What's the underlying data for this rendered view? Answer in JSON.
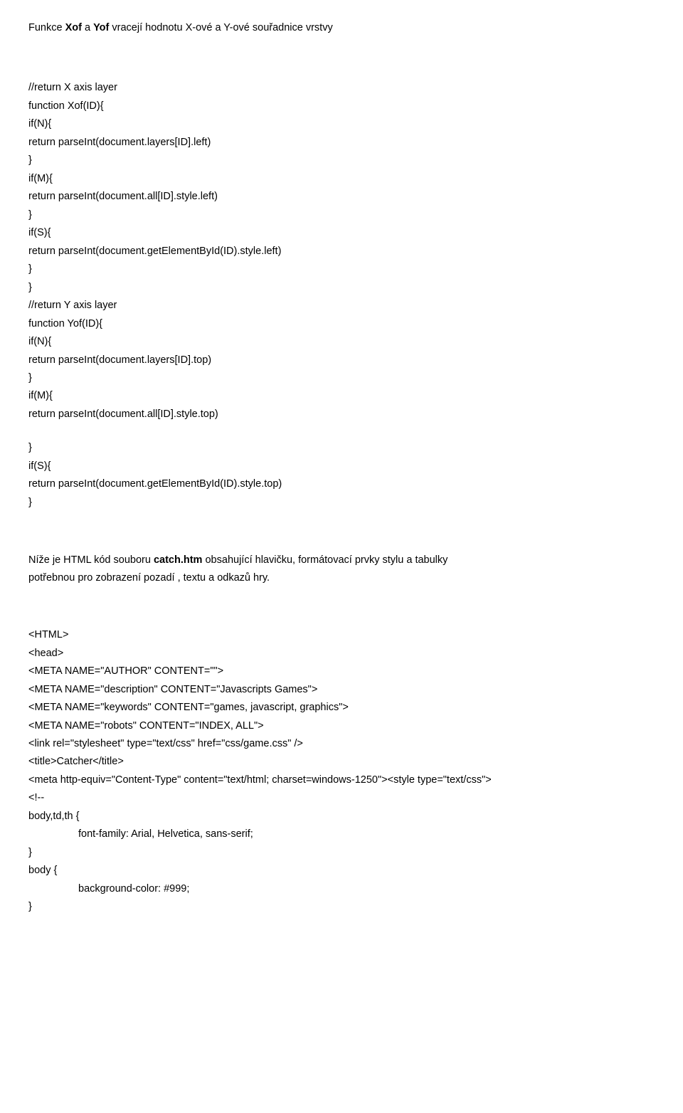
{
  "heading": {
    "prefix": "Funkce ",
    "b1": "Xof",
    "mid": "  a ",
    "b2": "Yof",
    "suffix": " vracejí hodnotu X-ové a Y-ové souřadnice vrstvy"
  },
  "code1": [
    "//return X axis layer",
    "function Xof(ID){",
    "if(N){",
    "return parseInt(document.layers[ID].left)",
    "}",
    "if(M){",
    "return parseInt(document.all[ID].style.left)",
    "}",
    "if(S){",
    "return parseInt(document.getElementById(ID).style.left)",
    "}",
    "}",
    "//return Y axis layer",
    "function Yof(ID){",
    "if(N){",
    "return parseInt(document.layers[ID].top)",
    "}",
    "if(M){",
    "return parseInt(document.all[ID].style.top)"
  ],
  "code1b": [
    "}",
    "if(S){",
    "return parseInt(document.getElementById(ID).style.top)",
    "}"
  ],
  "desc": {
    "line1_prefix": "Níže je HTML kód  souboru ",
    "line1_bold": "catch.htm",
    "line1_suffix": " obsahující hlavičku, formátovací prvky stylu a tabulky",
    "line2": "potřebnou pro zobrazení  pozadí , textu a odkazů hry."
  },
  "code2": [
    "<HTML>",
    "<head>",
    "<META NAME=\"AUTHOR\" CONTENT=\"\">",
    "<META NAME=\"description\" CONTENT=\"Javascripts Games\">",
    "<META NAME=\"keywords\" CONTENT=\"games, javascript, graphics\">",
    "<META NAME=\"robots\" CONTENT=\"INDEX, ALL\">",
    " <link rel=\"stylesheet\" type=\"text/css\" href=\"css/game.css\" />",
    "<title>Catcher</title>",
    "<meta http-equiv=\"Content-Type\" content=\"text/html; charset=windows-1250\"><style type=\"text/css\">",
    "<!--",
    "body,td,th {"
  ],
  "code2_indent1": "font-family: Arial, Helvetica, sans-serif;",
  "code2_tail": [
    "}",
    "body {"
  ],
  "code2_indent2": "background-color: #999;",
  "code2_close": "}"
}
